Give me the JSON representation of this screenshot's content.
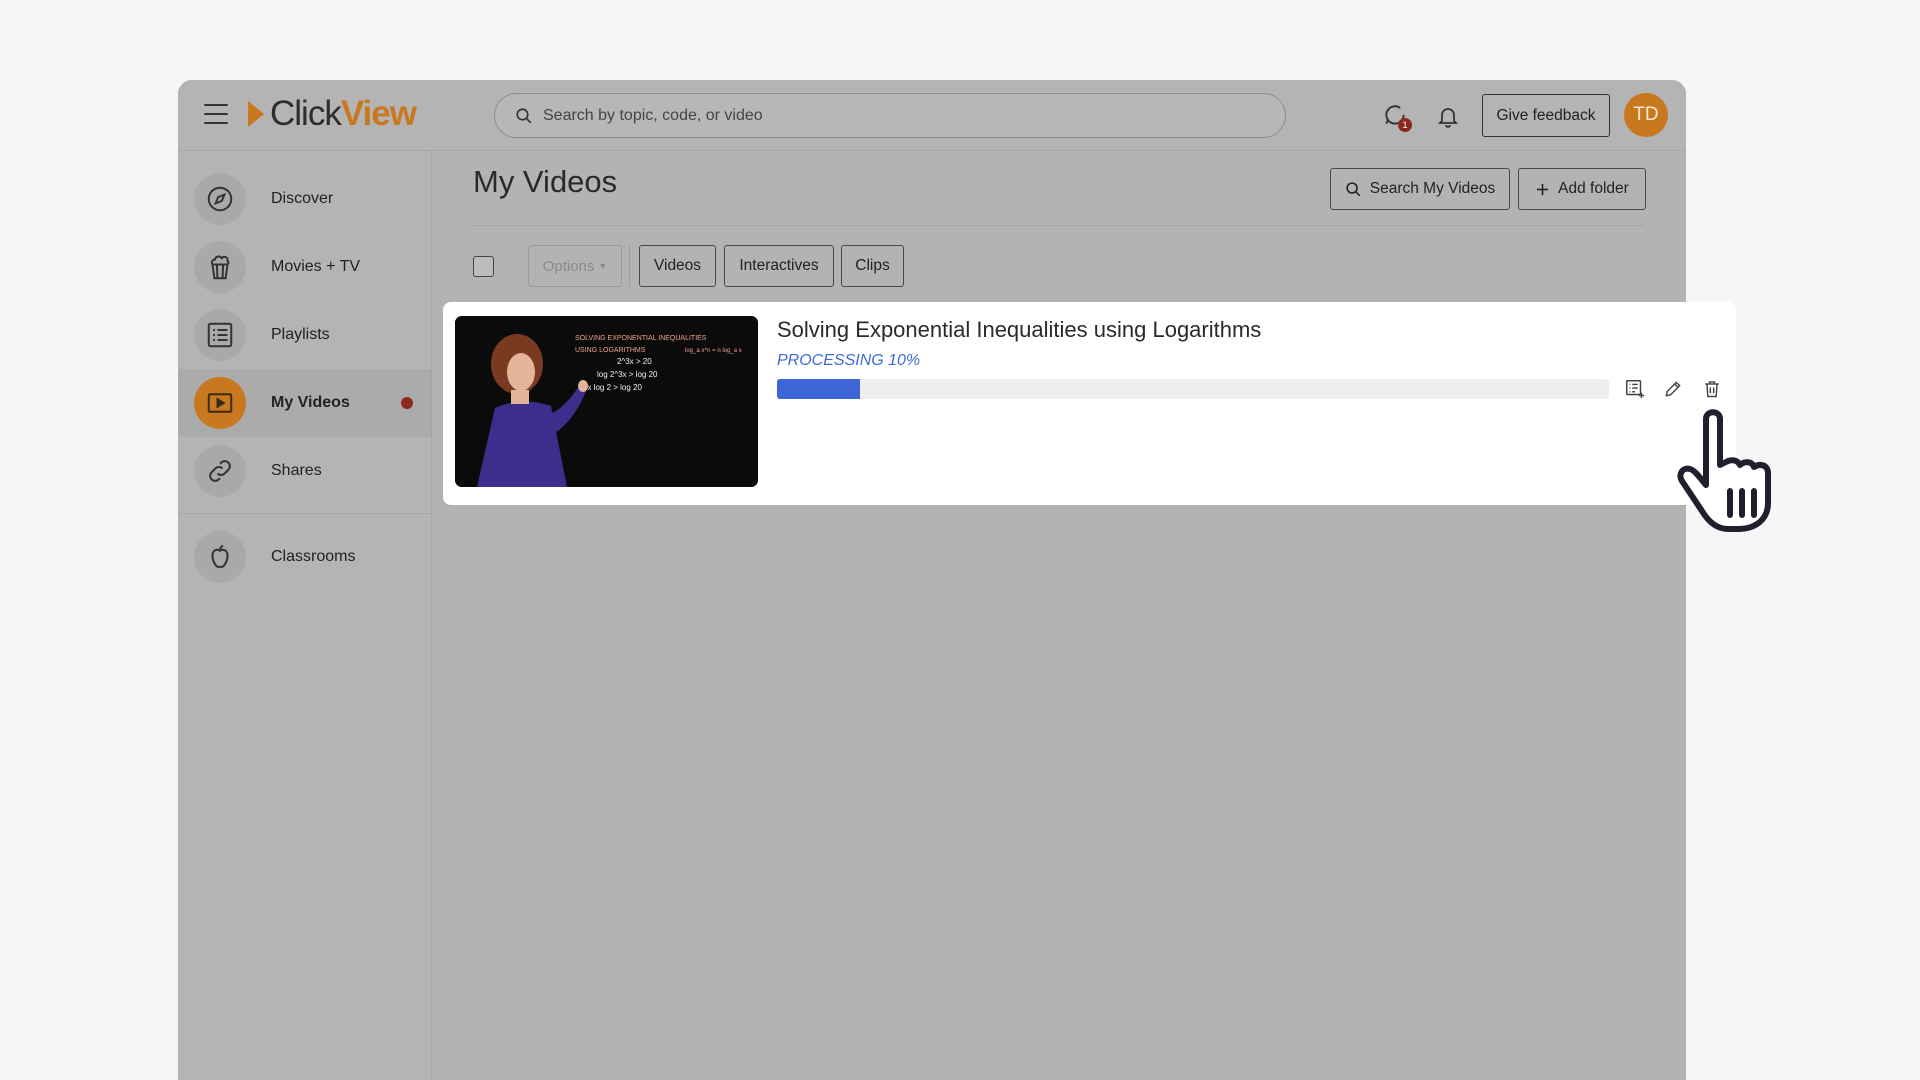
{
  "header": {
    "logo_part1": "Click",
    "logo_part2": "View",
    "search_placeholder": "Search by topic, code, or video",
    "notification_count": "1",
    "feedback_label": "Give feedback",
    "avatar_initials": "TD"
  },
  "sidebar": {
    "items": [
      {
        "label": "Discover",
        "icon": "compass-icon"
      },
      {
        "label": "Movies + TV",
        "icon": "popcorn-icon"
      },
      {
        "label": "Playlists",
        "icon": "list-icon"
      },
      {
        "label": "My Videos",
        "icon": "play-icon"
      },
      {
        "label": "Shares",
        "icon": "link-icon"
      },
      {
        "label": "Classrooms",
        "icon": "apple-icon"
      }
    ]
  },
  "main": {
    "title": "My Videos",
    "search_my_videos_label": "Search My Videos",
    "add_folder_label": "Add folder",
    "options_label": "Options",
    "filters": [
      "Videos",
      "Interactives",
      "Clips"
    ]
  },
  "video": {
    "title": "Solving Exponential Inequalities using Logarithms",
    "status": "PROCESSING 10%",
    "progress": 0.1,
    "thumbnail_text": {
      "line1": "SOLVING EXPONENTIAL INEQUALITIES",
      "line2": "USING LOGARITHMS",
      "line3": "2^3x > 20",
      "line4": "log 2^3x > log 20",
      "line5": "3x log 2 > log 20",
      "side": "log_a x^n = n log_a x"
    }
  },
  "colors": {
    "accent": "#c8781e",
    "progress": "#3e65d6",
    "badge": "#8a2a1e"
  }
}
